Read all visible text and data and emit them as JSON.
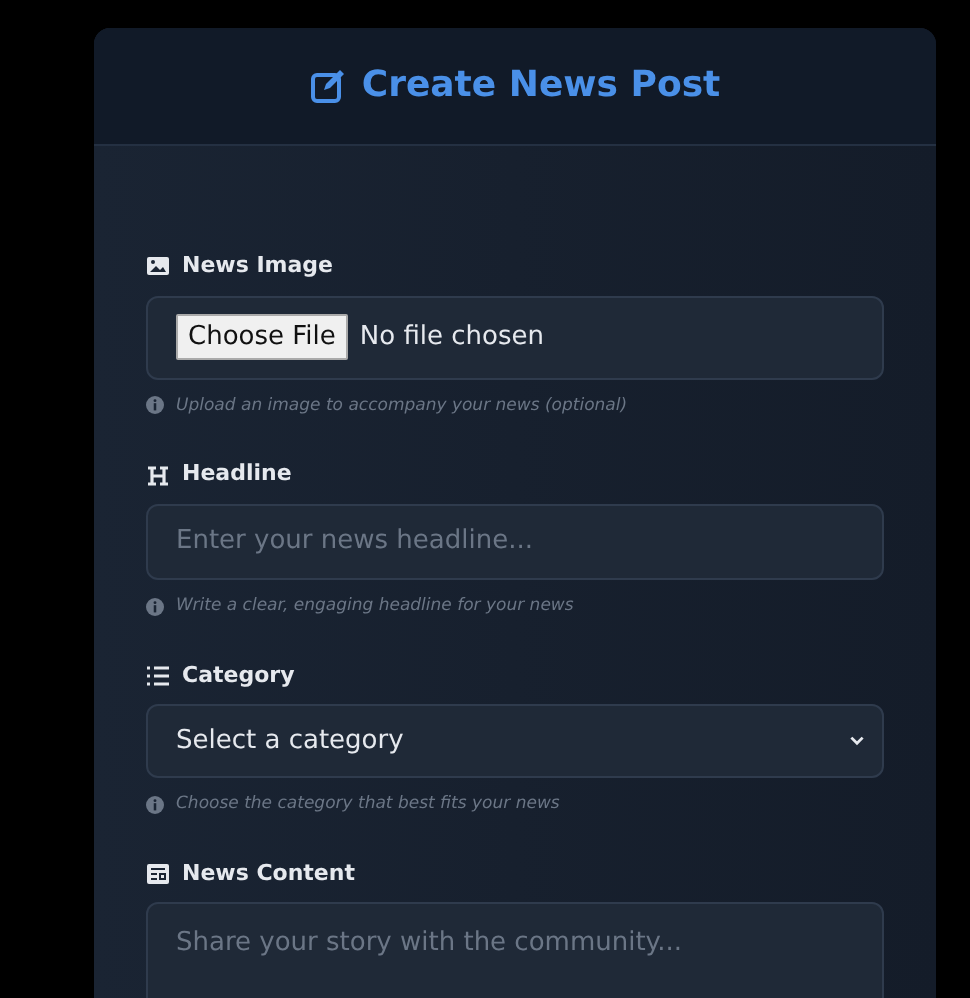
{
  "header": {
    "title": "Create News Post"
  },
  "fields": [
    {
      "kind": "file",
      "label": "News Image",
      "button": "Choose File",
      "value": "No file chosen",
      "help": "Upload an image to accompany your news (optional)"
    },
    {
      "kind": "text",
      "label": "Headline",
      "placeholder": "Enter your news headline...",
      "help": "Write a clear, engaging headline for your news"
    },
    {
      "kind": "select",
      "label": "Category",
      "value": "Select a category",
      "help": "Choose the category that best fits your news"
    },
    {
      "kind": "textarea",
      "label": "News Content",
      "placeholder": "Share your story with the community..."
    }
  ]
}
